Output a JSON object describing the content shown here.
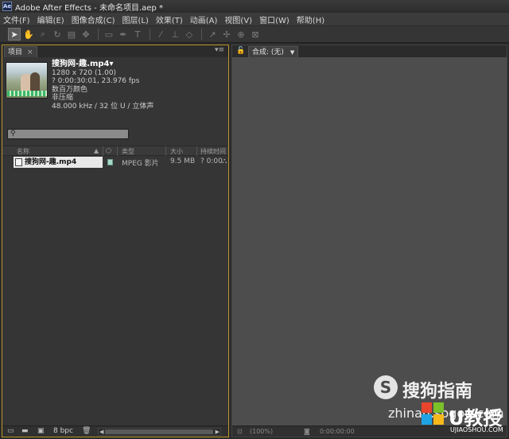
{
  "window": {
    "title": "Adobe After Effects - 未命名项目.aep *",
    "icon_text": "Ae"
  },
  "menu": [
    "文件(F)",
    "编辑(E)",
    "图像合成(C)",
    "图层(L)",
    "效果(T)",
    "动画(A)",
    "视图(V)",
    "窗口(W)",
    "帮助(H)"
  ],
  "toolbar": {
    "tools": [
      "selection-icon",
      "hand-icon",
      "zoom-icon",
      "rotate-icon",
      "camera-icon",
      "pan-behind-icon",
      "mask-icon",
      "pen-icon",
      "text-icon",
      "brush-icon",
      "clone-icon",
      "eraser-icon",
      "roto-icon",
      "puppet-icon"
    ]
  },
  "project_panel": {
    "tab_label": "项目",
    "tab_close": "×",
    "panel_menu": "▾≡",
    "selected_file": {
      "name": "搜狗网-趣.mp4▾",
      "resolution": "1280 x 720 (1.00)",
      "duration": "? 0:00:30:01, 23.976 fps",
      "color": "数百万颜色",
      "compression": "非压缩",
      "audio": "48.000 kHz / 32 位 U / 立体声"
    },
    "search": {
      "placeholder": ""
    },
    "columns": [
      "名称",
      "类型",
      "大小",
      "持续时间"
    ],
    "items": [
      {
        "name": "搜狗网-趣.mp4",
        "type": "MPEG 影片",
        "size": "9.5 MB",
        "duration": "? 0:00",
        "label_color": "#a6d9c8"
      }
    ],
    "bpc": "8 bpc"
  },
  "comp_panel": {
    "tab_label": "合成: (无)",
    "tab_dropdown": "▼",
    "bottom_zoom": "(100%)",
    "bottom_time": "0:00:00:00"
  },
  "watermark": {
    "brand": "搜狗指南",
    "url": "zhinan.sogou.com",
    "u_brand": "U教授",
    "u_site": "UJIAOSHOU.COM"
  }
}
